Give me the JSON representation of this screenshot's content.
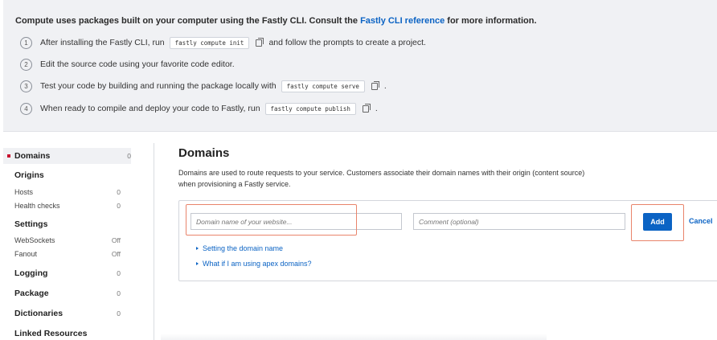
{
  "banner": {
    "intro_text": "Compute uses packages built on your computer using the Fastly CLI. Consult the",
    "intro_link": "Fastly CLI reference",
    "intro_suffix": "for more information.",
    "steps": [
      {
        "num": "1",
        "before": "After installing the Fastly CLI, run",
        "code": "fastly compute init",
        "after": "and follow the prompts to create a project."
      },
      {
        "num": "2",
        "before": "Edit the source code using your favorite code editor.",
        "code": "",
        "after": ""
      },
      {
        "num": "3",
        "before": "Test your code by building and running the package locally with",
        "code": "fastly compute serve",
        "after": "."
      },
      {
        "num": "4",
        "before": "When ready to compile and deploy your code to Fastly, run",
        "code": "fastly compute publish",
        "after": "."
      }
    ]
  },
  "sidebar": {
    "items": [
      {
        "label": "Domains",
        "count": "0"
      },
      {
        "label": "Origins",
        "count": ""
      },
      {
        "label": "Hosts",
        "count": "0"
      },
      {
        "label": "Health checks",
        "count": "0"
      },
      {
        "label": "Settings",
        "count": ""
      },
      {
        "label": "WebSockets",
        "count": "Off"
      },
      {
        "label": "Fanout",
        "count": "Off"
      },
      {
        "label": "Logging",
        "count": "0"
      },
      {
        "label": "Package",
        "count": "0"
      },
      {
        "label": "Dictionaries",
        "count": "0"
      },
      {
        "label": "Linked Resources",
        "count": ""
      }
    ]
  },
  "main": {
    "title": "Domains",
    "description": "Domains are used to route requests to your service. Customers associate their domain names with their origin (content source) when provisioning a Fastly service.",
    "domain_placeholder": "Domain name of your website...",
    "comment_placeholder": "Comment (optional)",
    "add_label": "Add",
    "cancel_label": "Cancel",
    "links": [
      "Setting the domain name",
      "What if I am using apex domains?"
    ]
  },
  "colors": {
    "accent": "#0b63c4",
    "highlight": "#e9846b",
    "active_marker": "#c8102e"
  }
}
